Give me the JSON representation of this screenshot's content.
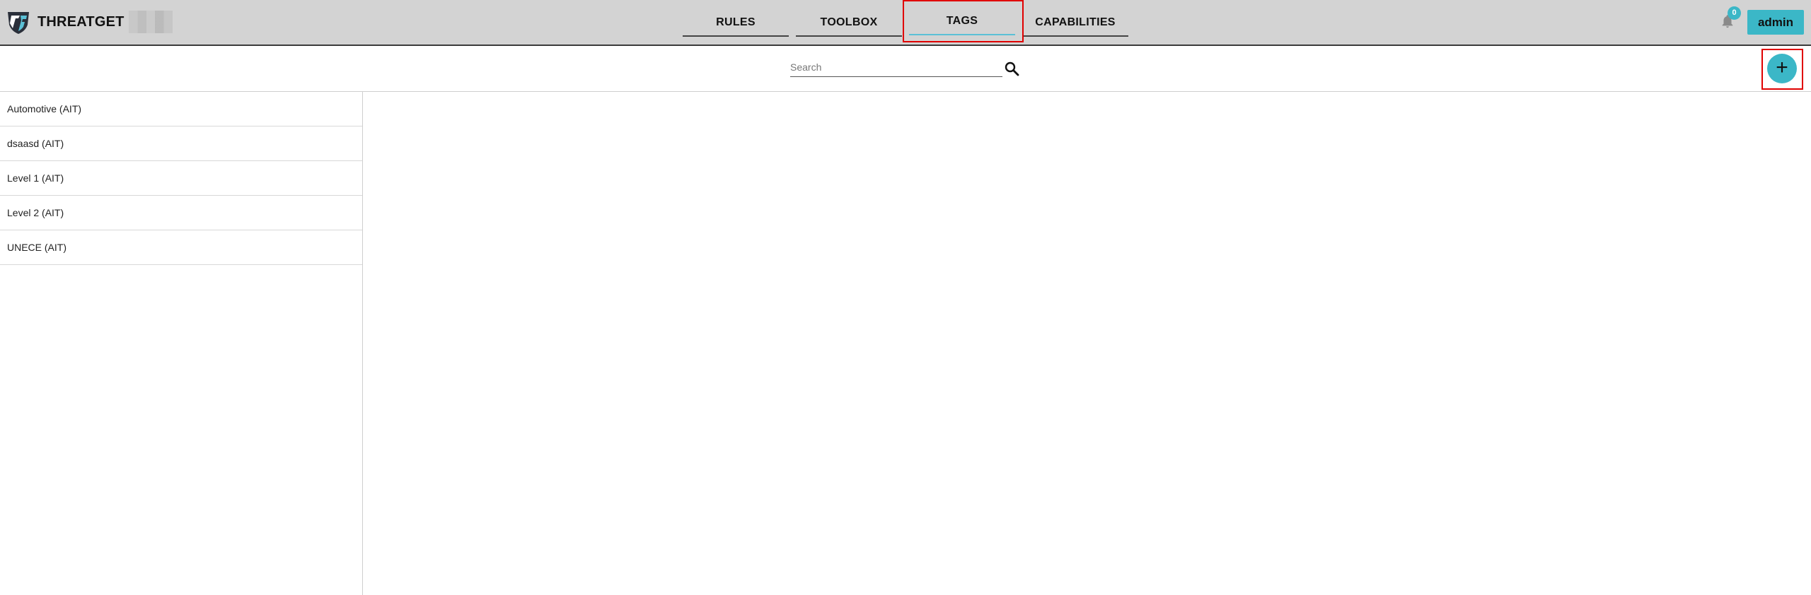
{
  "brand": {
    "name": "THREATGET",
    "logo_icon": "threatget-shield-logo-icon"
  },
  "nav": {
    "tabs": [
      {
        "label": "RULES",
        "active": false
      },
      {
        "label": "TOOLBOX",
        "active": false
      },
      {
        "label": "TAGS",
        "active": true
      },
      {
        "label": "CAPABILITIES",
        "active": false
      }
    ]
  },
  "header": {
    "notifications_icon": "bell-icon",
    "notification_count": "0",
    "user_label": "admin"
  },
  "search": {
    "placeholder": "Search",
    "value": "",
    "icon": "search-icon"
  },
  "toolbar": {
    "add_label": "+"
  },
  "tags_list": {
    "items": [
      {
        "label": "Automotive (AIT)"
      },
      {
        "label": "dsaasd (AIT)"
      },
      {
        "label": "Level 1 (AIT)"
      },
      {
        "label": "Level 2 (AIT)"
      },
      {
        "label": "UNECE (AIT)"
      }
    ]
  },
  "colors": {
    "accent": "#3bb7c7",
    "topbar_bg": "#d3d3d3",
    "highlight": "#e00000"
  }
}
